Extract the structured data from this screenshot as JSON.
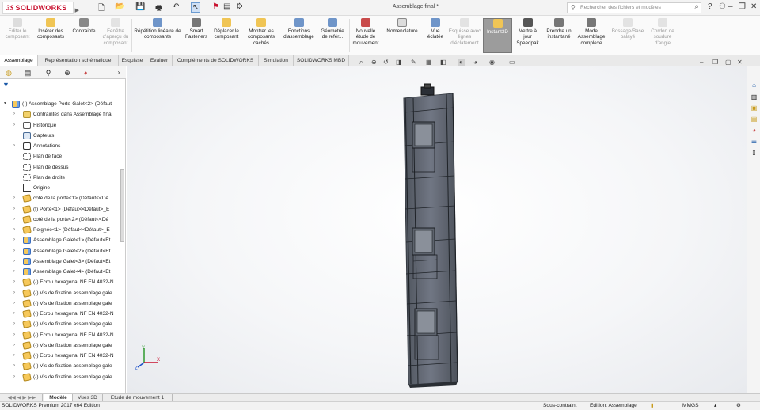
{
  "app": {
    "logo_ds": "3S",
    "logo_text": "SOLIDWORKS",
    "doc_title": "Assemblage final *",
    "search_placeholder": "Rechercher des fichiers et modèles"
  },
  "toolbar": [
    {
      "label": "Editer le composant",
      "disabled": true
    },
    {
      "label": "Insérer des composants",
      "disabled": false
    },
    {
      "label": "Contrainte",
      "disabled": false
    },
    {
      "label": "Fenêtre d'aperçu du composant",
      "disabled": true
    },
    {
      "label": "Répétition linéaire de composants",
      "disabled": false
    },
    {
      "label": "Smart Fasteners",
      "disabled": false
    },
    {
      "label": "Déplacer le composant",
      "disabled": false
    },
    {
      "label": "Montrer les composants cachés",
      "disabled": false
    },
    {
      "label": "Fonctions d'assemblage",
      "disabled": false
    },
    {
      "label": "Géométrie de référ...",
      "disabled": false
    },
    {
      "label": "Nouvelle étude de mouvement",
      "disabled": false
    },
    {
      "label": "Nomenclature",
      "disabled": false
    },
    {
      "label": "Vue éclatée",
      "disabled": false
    },
    {
      "label": "Esquisse avec lignes d'éclatement",
      "disabled": true
    },
    {
      "label": "Instant3D",
      "disabled": false,
      "active": true
    },
    {
      "label": "Mettre à jour Speedpak",
      "disabled": false
    },
    {
      "label": "Prendre un instantané",
      "disabled": false
    },
    {
      "label": "Mode Assemblage complexe",
      "disabled": false
    },
    {
      "label": "Bossage/Base balayé",
      "disabled": true
    },
    {
      "label": "Cordon de soudure d'angle",
      "disabled": true
    }
  ],
  "tabs": [
    "Assemblage",
    "Représentation schématique",
    "Esquisse",
    "Evaluer",
    "Compléments de SOLIDWORKS",
    "Simulation",
    "SOLIDWORKS MBD"
  ],
  "tree": {
    "root": "(-) Assemblage Porte-Galet<2> (Défaut",
    "items": [
      {
        "label": "Contraintes dans Assemblage fina",
        "icon": "folder",
        "exp": true
      },
      {
        "label": "Historique",
        "icon": "hist",
        "exp": true
      },
      {
        "label": "Capteurs",
        "icon": "cap",
        "exp": false
      },
      {
        "label": "Annotations",
        "icon": "ann",
        "exp": true
      },
      {
        "label": "Plan de face",
        "icon": "plane",
        "exp": false
      },
      {
        "label": "Plan de dessus",
        "icon": "plane",
        "exp": false
      },
      {
        "label": "Plan de droite",
        "icon": "plane",
        "exp": false
      },
      {
        "label": "Origine",
        "icon": "origin",
        "exp": false
      },
      {
        "label": "coté de la porte<1> (Défaut<<Dé",
        "icon": "part",
        "exp": true
      },
      {
        "label": "(f) Porte<1> (Défaut<<Défaut>_E",
        "icon": "part",
        "exp": true
      },
      {
        "label": "coté de la porte<2> (Défaut<<Dé",
        "icon": "part",
        "exp": true
      },
      {
        "label": "Poignée<1> (Défaut<<Défaut>_E",
        "icon": "part",
        "exp": true
      },
      {
        "label": "Assemblage Galet<1> (Défaut<Et",
        "icon": "asm",
        "exp": true
      },
      {
        "label": "Assemblage Galet<2> (Défaut<Et",
        "icon": "asm",
        "exp": true
      },
      {
        "label": "Assemblage Galet<3> (Défaut<Et",
        "icon": "asm",
        "exp": true
      },
      {
        "label": "Assemblage Galet<4> (Défaut<Et",
        "icon": "asm",
        "exp": true
      },
      {
        "label": "(-) Ecrou hexagonal NF EN 4032-N",
        "icon": "part",
        "exp": true
      },
      {
        "label": "(-) Vis de fixation assemblage gale",
        "icon": "part",
        "exp": true
      },
      {
        "label": "(-) Vis de fixation assemblage gale",
        "icon": "part",
        "exp": true
      },
      {
        "label": "(-) Ecrou hexagonal NF EN 4032-N",
        "icon": "part",
        "exp": true
      },
      {
        "label": "(-) Vis de fixation assemblage gale",
        "icon": "part",
        "exp": true
      },
      {
        "label": "(-) Ecrou hexagonal NF EN 4032-N",
        "icon": "part",
        "exp": true
      },
      {
        "label": "(-) Vis de fixation assemblage gale",
        "icon": "part",
        "exp": true
      },
      {
        "label": "(-) Ecrou hexagonal NF EN 4032-N",
        "icon": "part",
        "exp": true
      },
      {
        "label": "(-) Vis de fixation assemblage gale",
        "icon": "part",
        "exp": true
      },
      {
        "label": "(-) Vis de fixation assemblage gale",
        "icon": "part",
        "exp": true
      }
    ]
  },
  "bottom_tabs": [
    "Modèle",
    "Vues 3D",
    "Etude de mouvement 1"
  ],
  "status": {
    "left": "SOLIDWORKS Premium 2017 x64 Edition",
    "constraint": "Sous-contraint",
    "mode": "Edition: Assemblage",
    "units": "MMGS"
  },
  "triad": {
    "x": "X",
    "y": "Y",
    "z": "Z"
  },
  "colors": {
    "accent": "#c8102e",
    "active_tool": "#9c9c9c"
  }
}
